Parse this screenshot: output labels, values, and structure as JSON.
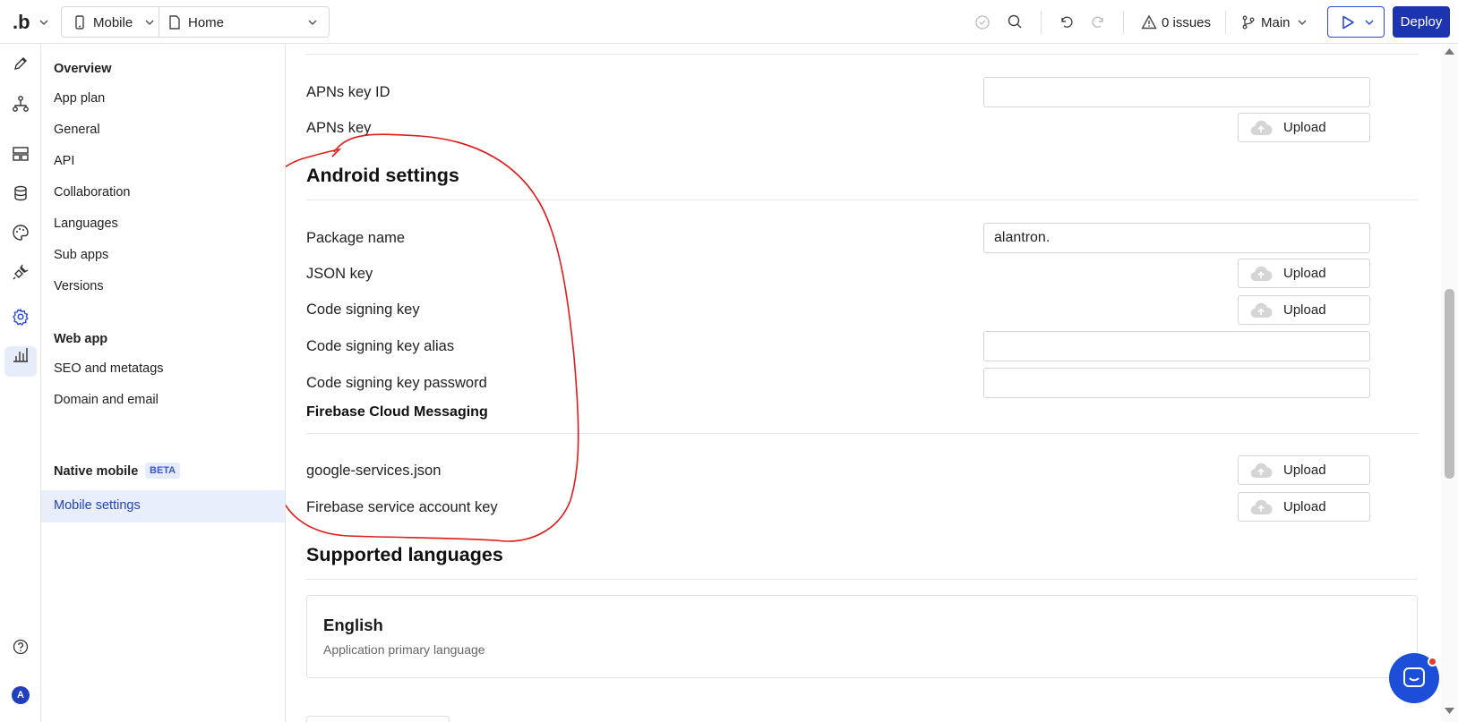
{
  "topbar": {
    "logo": ".b",
    "device": "Mobile",
    "page": "Home",
    "issues": "0 issues",
    "branch": "Main",
    "deploy": "Deploy"
  },
  "rail_icons": [
    "pencil-icon",
    "hierarchy-icon",
    "layout-icon",
    "database-icon",
    "palette-icon",
    "plug-icon",
    "gear-icon",
    "bar-chart-icon",
    "help-icon"
  ],
  "avatar": "A",
  "subnav": {
    "overview_heading": "Overview",
    "overview_items": [
      "App plan",
      "General",
      "API",
      "Collaboration",
      "Languages",
      "Sub apps",
      "Versions"
    ],
    "webapp_heading": "Web app",
    "webapp_items": [
      "SEO and metatags",
      "Domain and email"
    ],
    "native_heading": "Native mobile",
    "native_badge": "BETA",
    "native_items": [
      "Mobile settings"
    ]
  },
  "main": {
    "apns_key_id_label": "APNs key ID",
    "apns_key_label": "APNs key",
    "android_heading": "Android settings",
    "package_name_label": "Package name",
    "package_name_value": "alantron.",
    "json_key_label": "JSON key",
    "code_signing_key_label": "Code signing key",
    "code_signing_alias_label": "Code signing key alias",
    "code_signing_password_label": "Code signing key password",
    "firebase_heading": "Firebase Cloud Messaging",
    "google_services_label": "google-services.json",
    "firebase_account_label": "Firebase service account key",
    "upload_label": "Upload",
    "languages_heading": "Supported languages",
    "language_name": "English",
    "language_desc": "Application primary language"
  },
  "colors": {
    "accent": "#1d34b0",
    "active_bg": "#e8eefc",
    "annotation": "#e01b1b"
  }
}
